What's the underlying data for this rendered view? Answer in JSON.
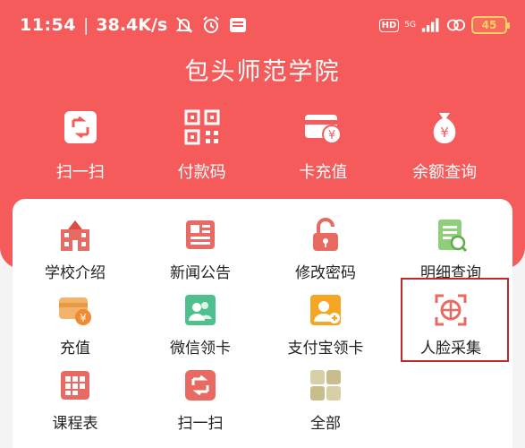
{
  "status_bar": {
    "time": "11:54",
    "separator": "|",
    "net_speed": "38.4K/s",
    "hd_label": "HD",
    "signal_label": "5G",
    "battery": "45",
    "icons": [
      "mute-icon",
      "alarm-icon",
      "app-notification-icon",
      "wifi-signal-icon",
      "cell-signal-icon",
      "cloud-icon",
      "battery-icon"
    ]
  },
  "header": {
    "title": "包头师范学院"
  },
  "quick_actions": [
    {
      "label": "扫一扫",
      "icon": "scan-icon"
    },
    {
      "label": "付款码",
      "icon": "qr-code-icon"
    },
    {
      "label": "卡充值",
      "icon": "card-recharge-icon"
    },
    {
      "label": "余额查询",
      "icon": "money-bag-icon"
    }
  ],
  "services": [
    {
      "label": "学校介绍",
      "icon": "school-building-icon"
    },
    {
      "label": "新闻公告",
      "icon": "newspaper-icon"
    },
    {
      "label": "修改密码",
      "icon": "unlock-icon"
    },
    {
      "label": "明细查询",
      "icon": "document-search-icon"
    },
    {
      "label": "充值",
      "icon": "recharge-card-icon"
    },
    {
      "label": "微信领卡",
      "icon": "wechat-card-icon"
    },
    {
      "label": "支付宝领卡",
      "icon": "alipay-card-icon"
    },
    {
      "label": "人脸采集",
      "icon": "face-capture-icon"
    },
    {
      "label": "课程表",
      "icon": "timetable-icon"
    },
    {
      "label": "扫一扫",
      "icon": "scan-icon"
    },
    {
      "label": "全部",
      "icon": "all-apps-icon"
    }
  ],
  "colors": {
    "brand_red": "#f65b5b",
    "highlight_border": "#c22a2a",
    "card_bg": "#ffffff",
    "page_bg": "#f4f4f4"
  }
}
